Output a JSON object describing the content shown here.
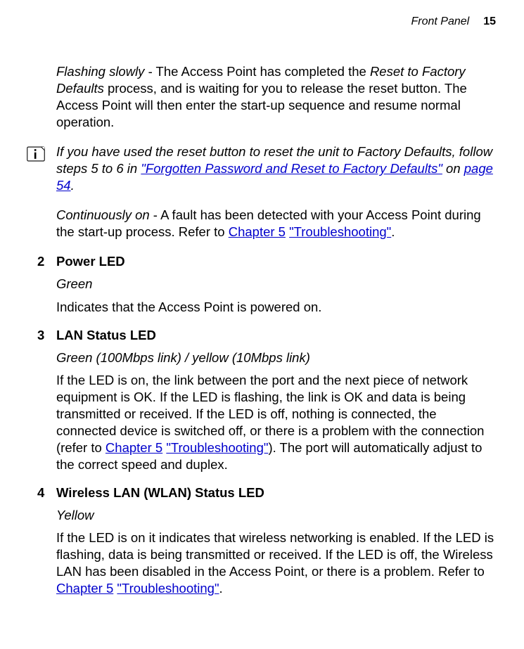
{
  "header": {
    "section": "Front Panel",
    "page": "15"
  },
  "para1": {
    "lead_italic": "Flashing slowly",
    "rest": " - The Access Point has completed the ",
    "italic2": "Reset to Factory Defaults",
    "rest2": " process, and is waiting for you to release the reset button. The Access Point will then enter the start-up sequence and resume normal operation."
  },
  "note": {
    "text1": "If you have used the reset button to reset the unit to Factory Defaults, follow steps 5 to 6 in ",
    "link1": "\"Forgotten Password and Reset to Factory Defaults\"",
    "text2": " on ",
    "link2": "page 54",
    "text3": "."
  },
  "para2": {
    "lead_italic": "Continuously on",
    "rest": " - A fault has been detected with your Access Point during the start-up process. Refer to ",
    "link1": "Chapter 5",
    "space": " ",
    "link2": "\"Troubleshooting\"",
    "rest2": "."
  },
  "item2": {
    "num": "2",
    "title": "Power LED",
    "color": "Green",
    "body": "Indicates that the Access Point is powered on."
  },
  "item3": {
    "num": "3",
    "title": "LAN Status LED",
    "color": "Green (100Mbps link) / yellow (10Mbps link)",
    "body1": "If the LED is on, the link between the port and the next piece of network equipment is OK. If the LED is flashing, the link is OK and data is being transmitted or received. If the LED is off, nothing is connected, the connected device is switched off, or there is a problem with the connection (refer to ",
    "link1": "Chapter 5",
    "space": " ",
    "link2": "\"Troubleshooting\"",
    "body2": "). The port will automatically adjust to the correct speed and duplex."
  },
  "item4": {
    "num": "4",
    "title": "Wireless LAN (WLAN) Status LED",
    "color": "Yellow",
    "body1": "If the LED is on it indicates that wireless networking is enabled. If the LED is flashing, data is being transmitted or received. If the LED is off, the Wireless LAN has been disabled in the Access Point, or there is a problem. Refer to ",
    "link1": "Chapter 5",
    "space": " ",
    "link2": "\"Troubleshooting\"",
    "body2": "."
  }
}
